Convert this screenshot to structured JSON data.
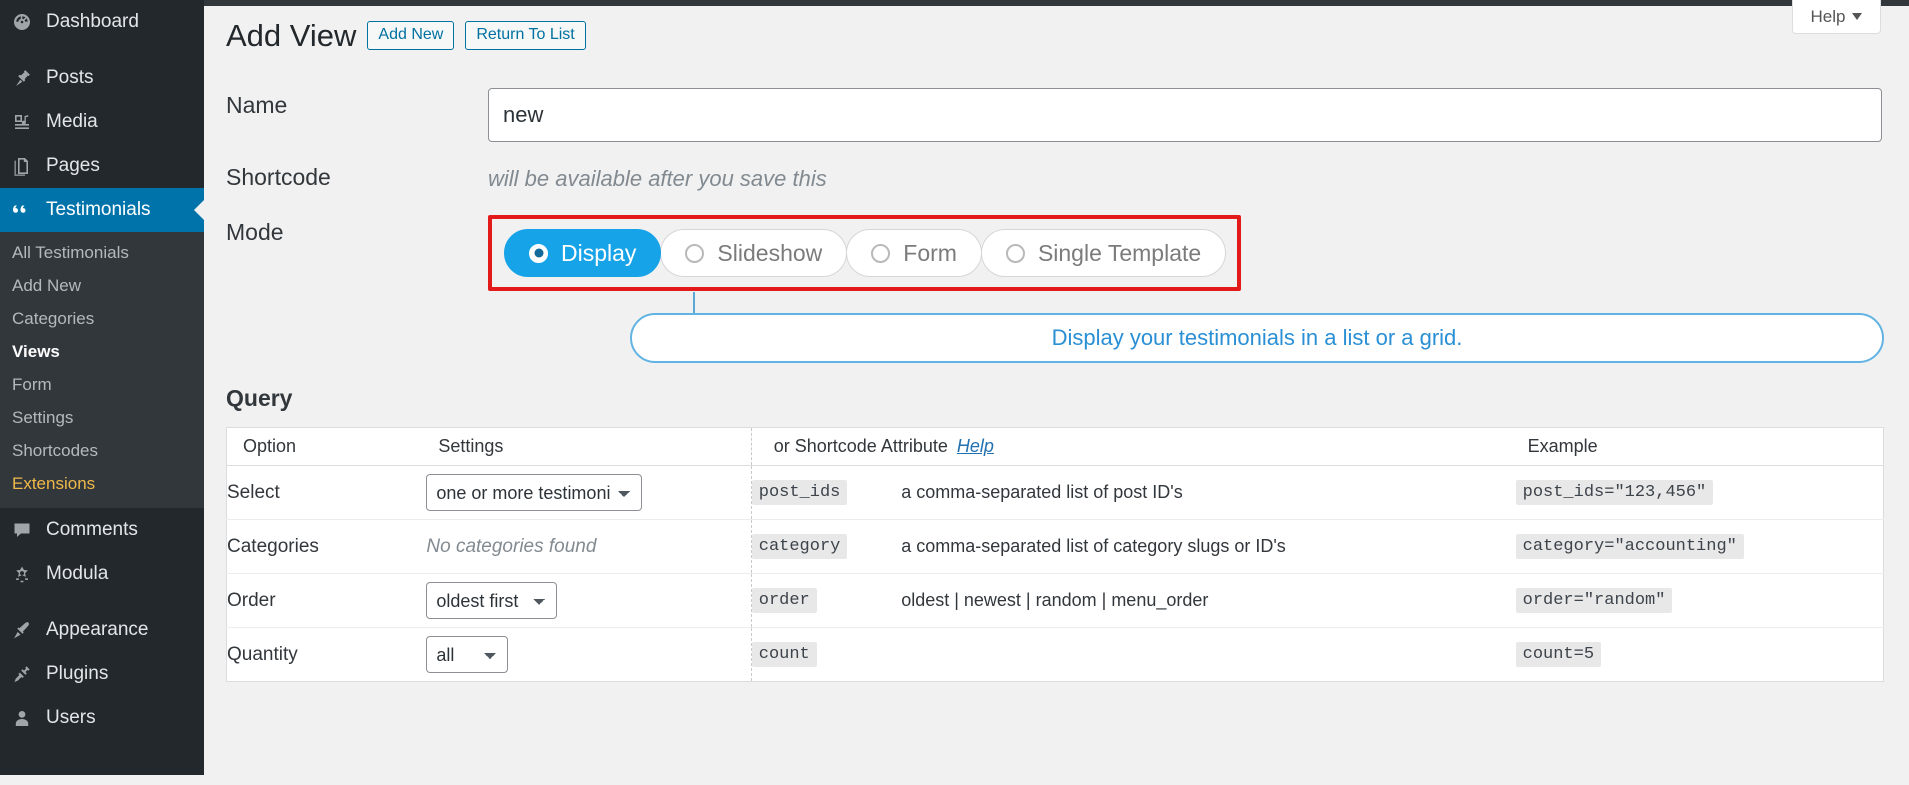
{
  "sidebar": {
    "items": [
      {
        "label": "Dashboard",
        "icon": "dashboard-icon",
        "active": false
      },
      {
        "label": "Posts",
        "icon": "pin-icon",
        "active": false
      },
      {
        "label": "Media",
        "icon": "media-icon",
        "active": false
      },
      {
        "label": "Pages",
        "icon": "pages-icon",
        "active": false
      },
      {
        "label": "Testimonials",
        "icon": "quote-icon",
        "active": true
      },
      {
        "label": "Comments",
        "icon": "comment-icon",
        "active": false
      },
      {
        "label": "Modula",
        "icon": "modula-icon",
        "active": false
      },
      {
        "label": "Appearance",
        "icon": "brush-icon",
        "active": false
      },
      {
        "label": "Plugins",
        "icon": "plug-icon",
        "active": false
      },
      {
        "label": "Users",
        "icon": "user-icon",
        "active": false
      }
    ],
    "submenu": [
      {
        "label": "All Testimonials",
        "state": "normal"
      },
      {
        "label": "Add New",
        "state": "normal"
      },
      {
        "label": "Categories",
        "state": "normal"
      },
      {
        "label": "Views",
        "state": "current"
      },
      {
        "label": "Form",
        "state": "normal"
      },
      {
        "label": "Settings",
        "state": "normal"
      },
      {
        "label": "Shortcodes",
        "state": "normal"
      },
      {
        "label": "Extensions",
        "state": "accent"
      }
    ]
  },
  "header": {
    "title": "Add View",
    "add_new_label": "Add New",
    "return_label": "Return To List",
    "help_label": "Help"
  },
  "form": {
    "name_label": "Name",
    "name_value": "new",
    "name_placeholder": "",
    "shortcode_label": "Shortcode",
    "shortcode_note": "will be available after you save this",
    "mode_label": "Mode",
    "mode_options": [
      {
        "label": "Display",
        "selected": true
      },
      {
        "label": "Slideshow",
        "selected": false
      },
      {
        "label": "Form",
        "selected": false
      },
      {
        "label": "Single Template",
        "selected": false
      }
    ],
    "mode_info": "Display your testimonials in a list or a grid."
  },
  "query": {
    "section_title": "Query",
    "columns": {
      "option": "Option",
      "settings": "Settings",
      "attribute": "or Shortcode Attribute",
      "attribute_help": "Help",
      "example": "Example"
    },
    "rows": [
      {
        "option": "Select",
        "control": "select",
        "control_size": "big",
        "value": "one or more testimonials",
        "options": [
          "one or more testimonials"
        ],
        "attribute": "post_ids",
        "description": "a comma-separated list of post ID's",
        "example": "post_ids=\"123,456\""
      },
      {
        "option": "Categories",
        "control": "text",
        "value": "No categories found",
        "attribute": "category",
        "description": "a comma-separated list of category slugs or ID's",
        "example": "category=\"accounting\""
      },
      {
        "option": "Order",
        "control": "select",
        "control_size": "mid",
        "value": "oldest first",
        "options": [
          "oldest first"
        ],
        "attribute": "order",
        "description": "oldest | newest | random | menu_order",
        "example": "order=\"random\""
      },
      {
        "option": "Quantity",
        "control": "select",
        "control_size": "small",
        "value": "all",
        "options": [
          "all"
        ],
        "attribute": "count",
        "description": "",
        "example": "count=5"
      }
    ]
  },
  "colors": {
    "sidebar_bg": "#23282d",
    "submenu_bg": "#32373c",
    "active_blue": "#0073aa",
    "accent_yellow": "#f0b849",
    "pill_blue": "#17a3e8",
    "info_blue": "#2a8fd4",
    "highlight_red": "#e31a1a",
    "page_bg": "#f1f1f1"
  }
}
